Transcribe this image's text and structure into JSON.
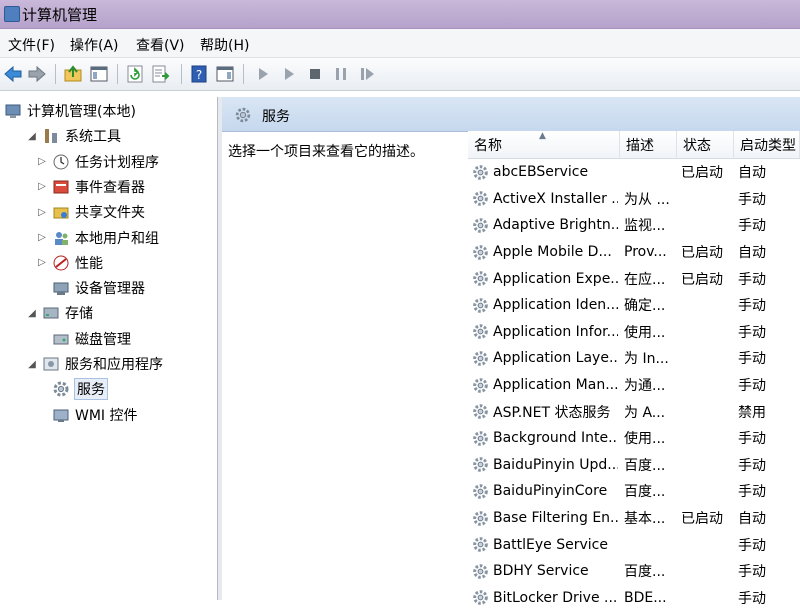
{
  "window": {
    "title": "计算机管理"
  },
  "menu": [
    {
      "label": "文件(F)"
    },
    {
      "label": "操作(A)"
    },
    {
      "label": "查看(V)"
    },
    {
      "label": "帮助(H)"
    }
  ],
  "toolbar": {
    "buttons": [
      {
        "icon": "back-arrow-icon"
      },
      {
        "icon": "forward-arrow-icon"
      },
      {
        "icon": "up-folder-icon"
      },
      {
        "icon": "show-hide-tree-icon"
      },
      {
        "icon": "refresh-icon"
      },
      {
        "icon": "export-list-icon"
      },
      {
        "icon": "help-icon"
      },
      {
        "icon": "action-pane-icon"
      },
      {
        "icon": "start-service-icon"
      },
      {
        "icon": "start-service-alt-icon"
      },
      {
        "icon": "stop-service-icon"
      },
      {
        "icon": "pause-service-icon"
      },
      {
        "icon": "resume-service-icon"
      }
    ]
  },
  "tree": {
    "nodes": [
      {
        "label": "计算机管理(本地)",
        "level": 0,
        "expander": "",
        "icon": "computer-icon"
      },
      {
        "label": "系统工具",
        "level": 1,
        "expander": "expanded",
        "icon": "tools-icon"
      },
      {
        "label": "任务计划程序",
        "level": 2,
        "expander": "collapsed",
        "icon": "clock-icon"
      },
      {
        "label": "事件查看器",
        "level": 2,
        "expander": "collapsed",
        "icon": "event-viewer-icon"
      },
      {
        "label": "共享文件夹",
        "level": 2,
        "expander": "collapsed",
        "icon": "shared-folder-icon"
      },
      {
        "label": "本地用户和组",
        "level": 2,
        "expander": "collapsed",
        "icon": "users-icon"
      },
      {
        "label": "性能",
        "level": 2,
        "expander": "collapsed",
        "icon": "performance-icon"
      },
      {
        "label": "设备管理器",
        "level": 2,
        "expander": "",
        "icon": "device-manager-icon"
      },
      {
        "label": "存储",
        "level": 1,
        "expander": "expanded",
        "icon": "storage-icon"
      },
      {
        "label": "磁盘管理",
        "level": 2,
        "expander": "",
        "icon": "disk-icon"
      },
      {
        "label": "服务和应用程序",
        "level": 1,
        "expander": "expanded",
        "icon": "services-apps-icon"
      },
      {
        "label": "服务",
        "level": 2,
        "expander": "",
        "icon": "gear-icon",
        "selected": true
      },
      {
        "label": "WMI 控件",
        "level": 2,
        "expander": "",
        "icon": "wmi-icon"
      }
    ]
  },
  "panel": {
    "title": "服务",
    "description": "选择一个项目来查看它的描述。"
  },
  "table": {
    "columns": [
      {
        "key": "name",
        "label": "名称"
      },
      {
        "key": "desc",
        "label": "描述"
      },
      {
        "key": "status",
        "label": "状态"
      },
      {
        "key": "startup",
        "label": "启动类型"
      }
    ],
    "rows": [
      {
        "name": "abcEBService",
        "desc": "",
        "status": "已启动",
        "startup": "自动"
      },
      {
        "name": "ActiveX Installer ...",
        "desc": "为从 ...",
        "status": "",
        "startup": "手动"
      },
      {
        "name": "Adaptive Brightn...",
        "desc": "监视...",
        "status": "",
        "startup": "手动"
      },
      {
        "name": "Apple Mobile D...",
        "desc": "Prov...",
        "status": "已启动",
        "startup": "自动"
      },
      {
        "name": "Application Expe...",
        "desc": "在应...",
        "status": "已启动",
        "startup": "手动"
      },
      {
        "name": "Application Iden...",
        "desc": "确定...",
        "status": "",
        "startup": "手动"
      },
      {
        "name": "Application Infor...",
        "desc": "使用...",
        "status": "",
        "startup": "手动"
      },
      {
        "name": "Application Laye...",
        "desc": "为 In...",
        "status": "",
        "startup": "手动"
      },
      {
        "name": "Application Man...",
        "desc": "为通...",
        "status": "",
        "startup": "手动"
      },
      {
        "name": "ASP.NET 状态服务",
        "desc": "为 A...",
        "status": "",
        "startup": "禁用"
      },
      {
        "name": "Background Inte...",
        "desc": "使用...",
        "status": "",
        "startup": "手动"
      },
      {
        "name": "BaiduPinyin Upd...",
        "desc": "百度...",
        "status": "",
        "startup": "手动"
      },
      {
        "name": "BaiduPinyinCore",
        "desc": "百度...",
        "status": "",
        "startup": "手动"
      },
      {
        "name": "Base Filtering En...",
        "desc": "基本...",
        "status": "已启动",
        "startup": "自动"
      },
      {
        "name": "BattlEye Service",
        "desc": "",
        "status": "",
        "startup": "手动"
      },
      {
        "name": "BDHY Service",
        "desc": "百度...",
        "status": "",
        "startup": "手动"
      },
      {
        "name": "BitLocker Drive ...",
        "desc": "BDE...",
        "status": "",
        "startup": "手动"
      }
    ]
  }
}
